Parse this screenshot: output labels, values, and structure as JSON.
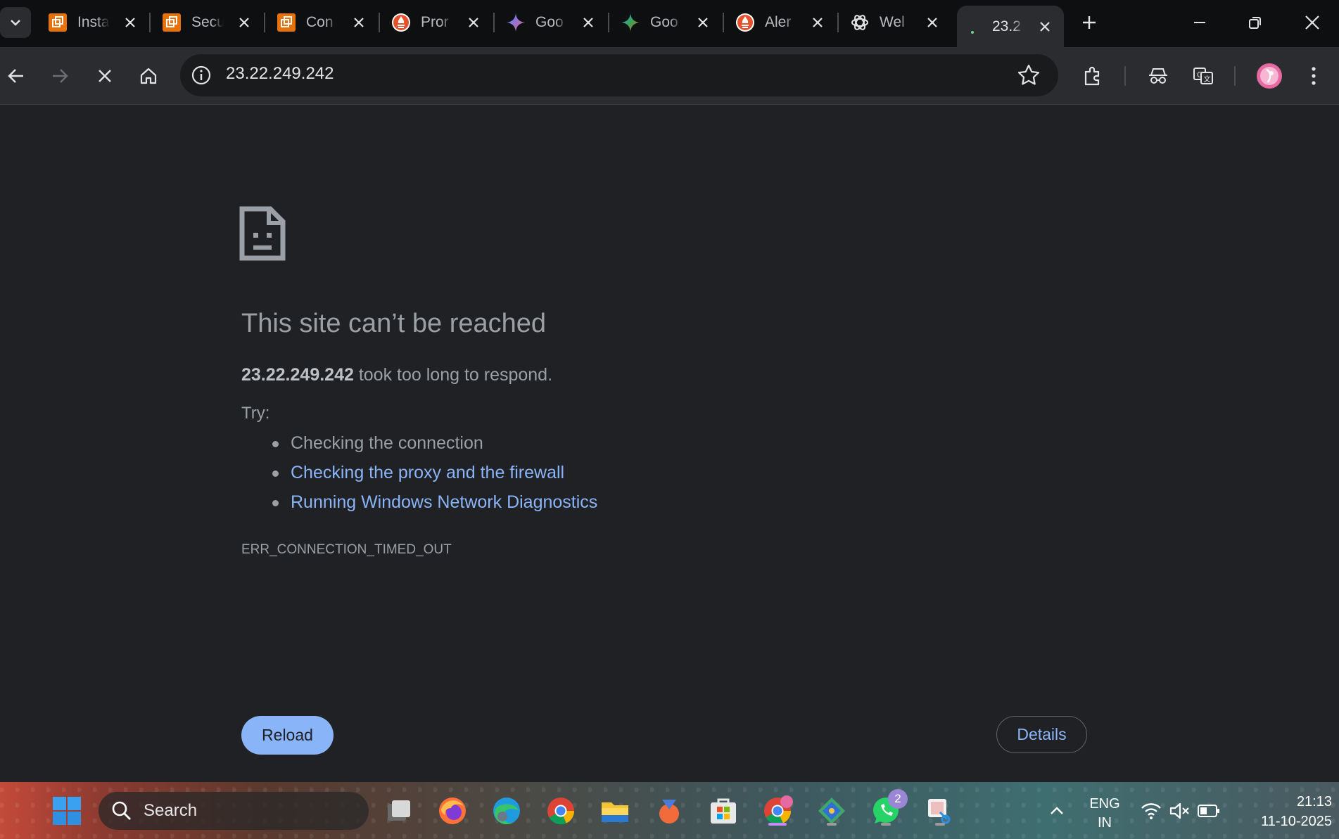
{
  "tabs": [
    {
      "title": "Insta",
      "icon": "orange-app-icon"
    },
    {
      "title": "Secu",
      "icon": "orange-app-icon"
    },
    {
      "title": "Con",
      "icon": "orange-app-icon"
    },
    {
      "title": "Pror",
      "icon": "red-flame-icon"
    },
    {
      "title": "Goo",
      "icon": "gemini-sparkle-icon"
    },
    {
      "title": "Goo",
      "icon": "gemini-sparkle-icon"
    },
    {
      "title": "Aler",
      "icon": "red-flame-icon"
    },
    {
      "title": "Wel",
      "icon": "chatgpt-icon"
    },
    {
      "title": "23.2",
      "icon": "loading-spinner-icon"
    }
  ],
  "address_bar": {
    "url": "23.22.249.242"
  },
  "error_page": {
    "heading": "This site can’t be reached",
    "host": "23.22.249.242",
    "message": " took too long to respond.",
    "try_label": "Try:",
    "suggestions": [
      {
        "text": "Checking the connection",
        "link": false
      },
      {
        "text": "Checking the proxy and the firewall",
        "link": true
      },
      {
        "text": "Running Windows Network Diagnostics",
        "link": true
      }
    ],
    "error_code": "ERR_CONNECTION_TIMED_OUT",
    "reload_label": "Reload",
    "details_label": "Details"
  },
  "taskbar": {
    "search_label": "Search",
    "whatsapp_badge": "2",
    "language_line1": "ENG",
    "language_line2": "IN",
    "time": "21:13",
    "date": "11-10-2025"
  },
  "colors": {
    "background": "#202124",
    "link": "#8ab4f8",
    "reload_button": "#8ab4f8"
  }
}
